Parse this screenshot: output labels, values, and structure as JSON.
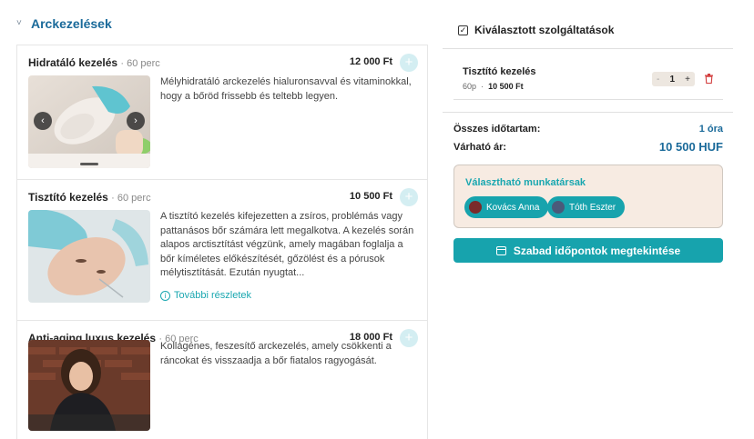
{
  "section": {
    "title": "Arckezelések"
  },
  "services": [
    {
      "name": "Hidratáló kezelés",
      "duration": "· 60 perc",
      "price": "12 000 Ft",
      "description": "Mélyhidratáló arckezelés hialuronsavval és vitaminokkal, hogy a bőröd frissebb és teltebb legyen."
    },
    {
      "name": "Tisztító kezelés",
      "duration": "· 60 perc",
      "price": "10 500 Ft",
      "description": "A tisztító kezelés kifejezetten a zsíros, problémás vagy pattanásos bőr számára lett megalkotva. A kezelés során alapos arctisztítást végzünk, amely magában foglalja a bőr kíméletes előkészítését, gőzölést és a pórusok mélytisztítását. Ezután nyugtat...",
      "more": "További részletek"
    },
    {
      "name": "Anti-aging luxus kezelés",
      "duration": "· 60 perc",
      "price": "18 000 Ft",
      "description": "Kollagénes, feszesítő arckezelés, amely csökkenti a ráncokat és visszaadja a bőr fiatalos ragyogását."
    }
  ],
  "selected": {
    "title": "Kiválasztott szolgáltatások",
    "item": {
      "name": "Tisztító kezelés",
      "duration": "60p",
      "sep": "·",
      "price": "10 500 Ft",
      "qty": "1",
      "minus": "-",
      "plus": "+"
    }
  },
  "summary": {
    "duration_label": "Összes időtartam:",
    "duration_value": "1 óra",
    "price_label": "Várható ár:",
    "price_value": "10 500 HUF"
  },
  "staff": {
    "title": "Választható munkatársak",
    "people": [
      "Kovács Anna",
      "Tóth Eszter"
    ]
  },
  "cta": {
    "label": "Szabad időpontok megtekintése"
  },
  "icons": {
    "add": "+",
    "chevron": "˅",
    "prev": "‹",
    "next": "›",
    "info": "i",
    "check": "✓",
    "trash": "🗑"
  },
  "colors": {
    "accent": "#17a3ad",
    "title_blue": "#1a6a9a",
    "staff_bg": "#f7ebe2"
  }
}
